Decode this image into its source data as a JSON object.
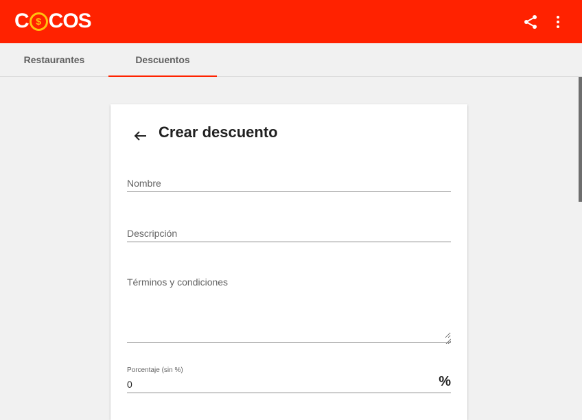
{
  "app": {
    "logo_parts": [
      "C",
      "$",
      "COS"
    ],
    "brand_color": "#ff2200",
    "logo_accent": "#ffc20e"
  },
  "appbar": {
    "icons": [
      "share-icon",
      "more-vert-icon"
    ]
  },
  "tabs": [
    {
      "label": "Restaurantes",
      "active": false
    },
    {
      "label": "Descuentos",
      "active": true
    }
  ],
  "form": {
    "title": "Crear descuento",
    "back_icon": "arrow-left-icon",
    "fields": {
      "name": {
        "placeholder": "Nombre",
        "value": ""
      },
      "description": {
        "placeholder": "Descripción",
        "value": ""
      },
      "terms": {
        "placeholder": "Términos y condiciones",
        "value": ""
      },
      "percentage": {
        "label_main": "Porcentaje",
        "label_hint": "(sin %)",
        "value": "0",
        "suffix": "%"
      }
    }
  }
}
